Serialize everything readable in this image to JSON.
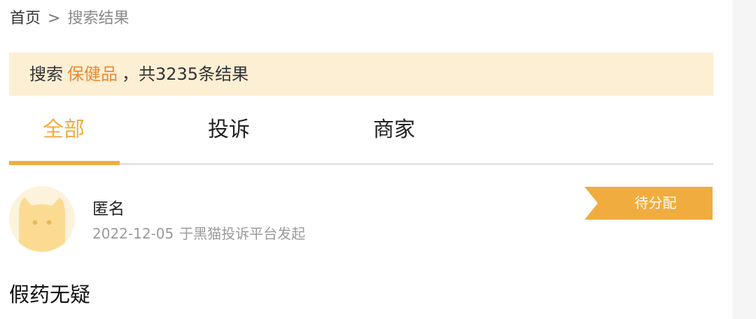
{
  "breadcrumb": {
    "home": "首页",
    "separator": ">",
    "current": "搜索结果"
  },
  "search_summary": {
    "prefix": "搜索",
    "keyword": "保健品",
    "suffix": "，共3235条结果",
    "keyword_color": "#ec8a32",
    "background_color": "#fdefd4"
  },
  "tabs": [
    {
      "label": "全部",
      "active": true
    },
    {
      "label": "投诉",
      "active": false
    },
    {
      "label": "商家",
      "active": false
    }
  ],
  "accent_color": "#f0ac3e",
  "results": [
    {
      "avatar_icon": "cat-avatar-icon",
      "user": "匿名",
      "date": "2022-12-05",
      "source": "于黑猫投诉平台发起",
      "status": "待分配",
      "title": "假药无疑"
    }
  ]
}
